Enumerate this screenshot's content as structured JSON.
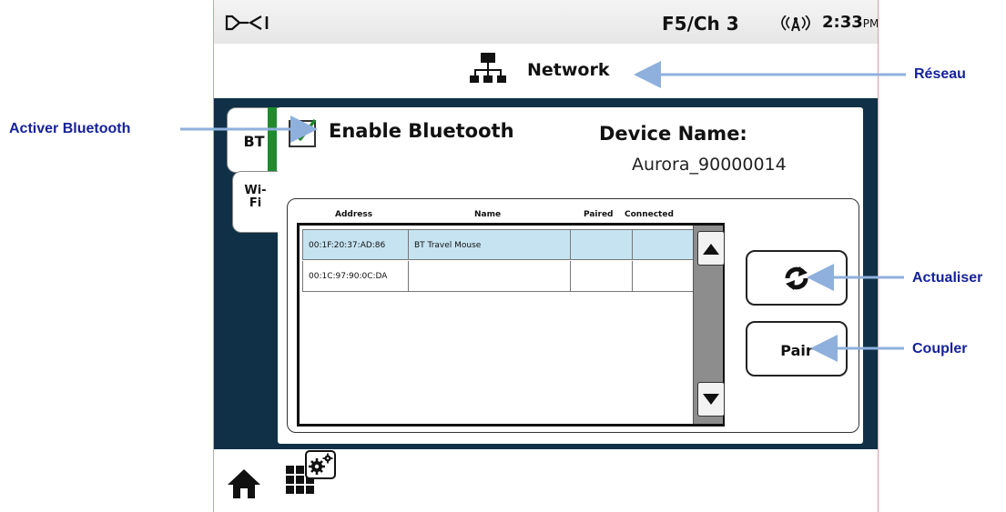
{
  "status": {
    "logo": "DCI",
    "frequency_channel": "F5/Ch 3",
    "time": "2:33",
    "time_suffix": "PM"
  },
  "header": {
    "title": "Network",
    "icon": "network-icon"
  },
  "tabs": [
    {
      "label": "BT",
      "active": true
    },
    {
      "label": "Wi-Fi",
      "active": false
    }
  ],
  "bluetooth": {
    "enable_label": "Enable Bluetooth",
    "enabled": true,
    "device_name_label": "Device Name:",
    "device_name": "Aurora_90000014"
  },
  "device_table": {
    "columns": [
      "Address",
      "Name",
      "Paired",
      "Connected"
    ],
    "rows": [
      {
        "address": "00:1F:20:37:AD:86",
        "name": "BT Travel Mouse",
        "paired": "",
        "connected": "",
        "selected": true
      },
      {
        "address": "00:1C:97:90:0C:DA",
        "name": "",
        "paired": "",
        "connected": "",
        "selected": false
      }
    ]
  },
  "buttons": {
    "refresh": "refresh-icon",
    "pair": "Pair"
  },
  "bottom_nav": {
    "home": "home-icon",
    "apps": "apps-settings-icon"
  },
  "annotations": {
    "network": "Réseau",
    "enable_bluetooth": "Activer Bluetooth",
    "refresh": "Actualiser",
    "pair": "Coupler"
  },
  "colors": {
    "annotation_text": "#16229b",
    "annotation_arrow": "#8fb0dd",
    "panel_background": "#0f3046",
    "active_tab_bar": "#1f8a2e",
    "selected_row": "#c6e3f1"
  }
}
